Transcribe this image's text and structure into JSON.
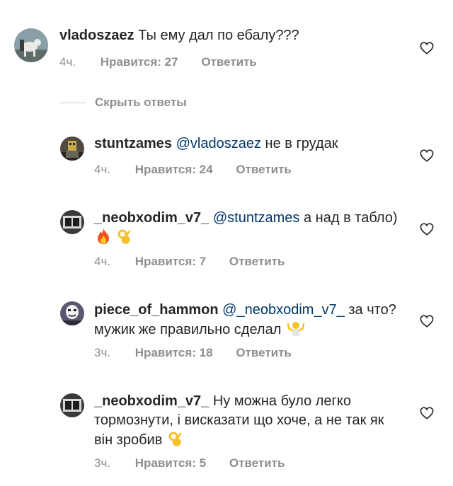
{
  "comments": [
    {
      "username": "vladoszaez",
      "mention": "",
      "text": "Ты ему дал по ебалу???",
      "time": "4ч.",
      "likes": "Нравится: 27",
      "reply": "Ответить"
    },
    {
      "username": "stuntzames",
      "mention": "@vladoszaez",
      "text": "не в грудак",
      "time": "4ч.",
      "likes": "Нравится: 24",
      "reply": "Ответить"
    },
    {
      "username": "_neobxodim_v7_",
      "mention": "@stuntzames",
      "text": "а над в табло)",
      "time": "4ч.",
      "likes": "Нравится: 7",
      "reply": "Ответить"
    },
    {
      "username": "piece_of_hammon",
      "mention": "@_neobxodim_v7_",
      "text": "за что? мужик же правильно сделал",
      "time": "3ч.",
      "likes": "Нравится: 18",
      "reply": "Ответить"
    },
    {
      "username": "_neobxodim_v7_",
      "mention": "",
      "text": "Ну можна було легко тормознути, і висказати що хоче, а не так як він зробив",
      "time": "3ч.",
      "likes": "Нравится: 5",
      "reply": "Ответить"
    }
  ],
  "hide_replies_label": "Скрыть ответы",
  "icons": {
    "like": "heart-outline-icon",
    "fire": "fire-emoji-icon",
    "ok_hand": "ok-hand-emoji-icon",
    "shrug": "shrug-emoji-icon"
  },
  "colors": {
    "text": "#262626",
    "secondary": "#8e8e8e",
    "mention": "#00376b"
  }
}
